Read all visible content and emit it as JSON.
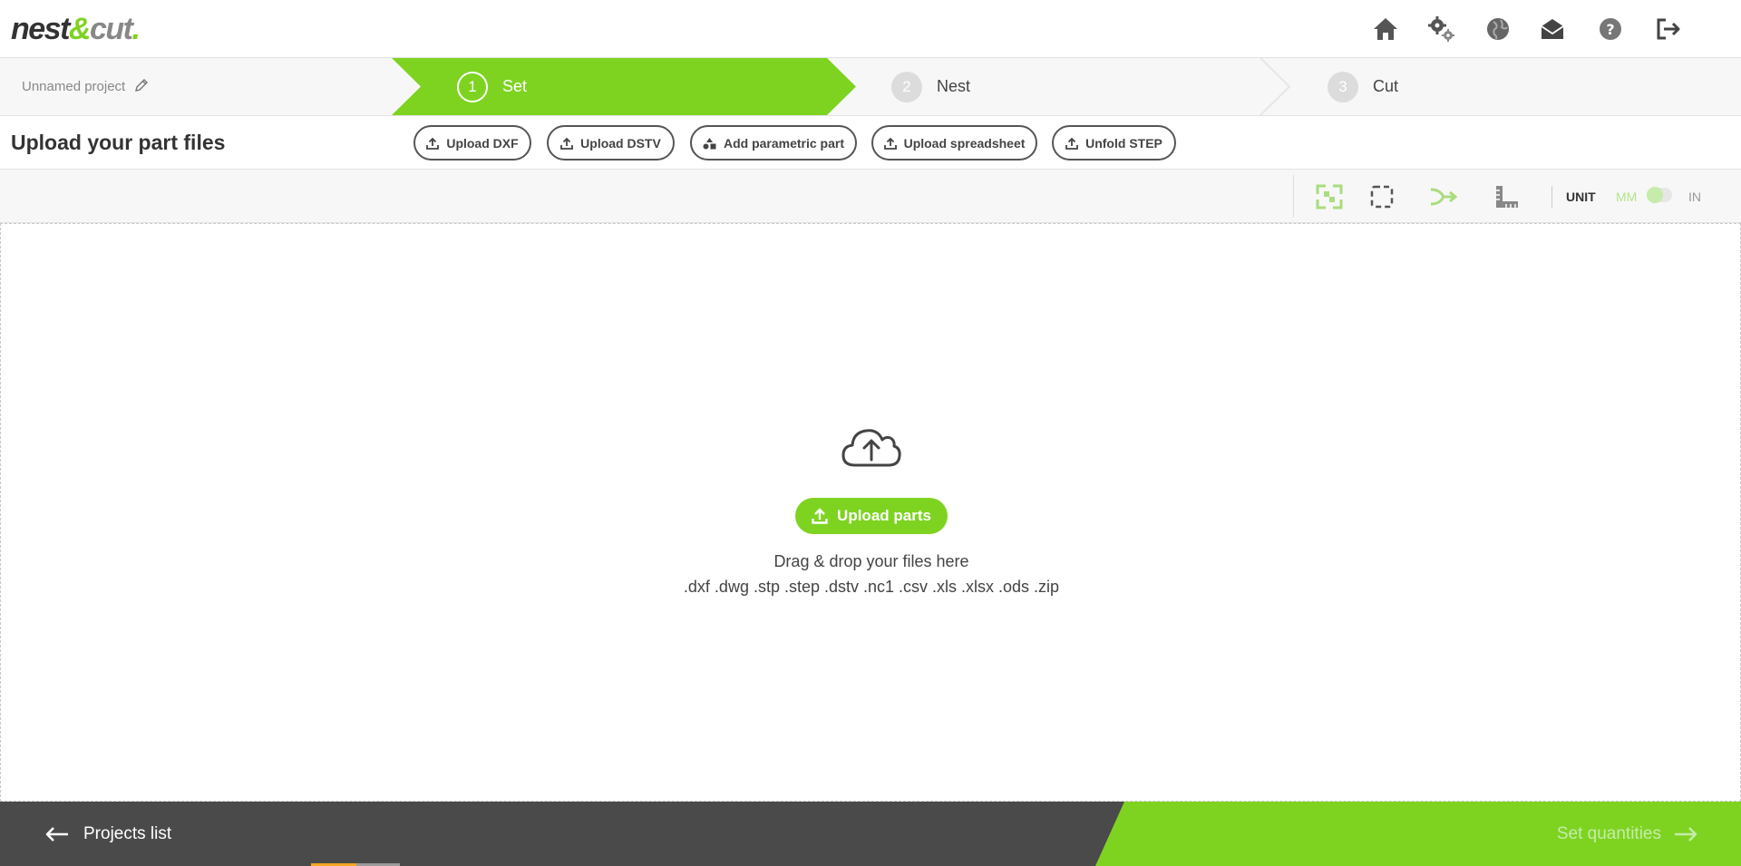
{
  "app": {
    "logo": {
      "part1": "nest",
      "amp": "&",
      "part2": "cut",
      "dot": "."
    }
  },
  "header": {
    "icons": [
      "home-icon",
      "settings-icon",
      "language-globe-icon",
      "mail-icon",
      "help-icon",
      "logout-icon"
    ]
  },
  "steps": {
    "project_name": "Unnamed project",
    "items": [
      {
        "number": "1",
        "label": "Set",
        "active": true
      },
      {
        "number": "2",
        "label": "Nest",
        "active": false
      },
      {
        "number": "3",
        "label": "Cut",
        "active": false
      }
    ]
  },
  "upload": {
    "title": "Upload your part files",
    "buttons": [
      {
        "label": "Upload DXF",
        "icon": "upload-icon"
      },
      {
        "label": "Upload DSTV",
        "icon": "upload-icon"
      },
      {
        "label": "Add parametric part",
        "icon": "shapes-icon"
      },
      {
        "label": "Upload spreadsheet",
        "icon": "upload-icon"
      },
      {
        "label": "Unfold STEP",
        "icon": "upload-icon"
      }
    ]
  },
  "toolbar": {
    "icons": [
      "arrange-icon",
      "select-frame-icon",
      "merge-arrow-icon",
      "ruler-icon"
    ],
    "unit_label": "UNIT",
    "unit_mm": "MM",
    "unit_in": "IN",
    "selected_unit": "MM"
  },
  "dropzone": {
    "icon": "cloud-upload-icon",
    "button_label": "Upload parts",
    "drag_text": "Drag & drop your files here",
    "extensions": ".dxf .dwg .stp .step .dstv .nc1 .csv .xls .xlsx .ods .zip"
  },
  "footer": {
    "back_label": "Projects list",
    "next_label": "Set quantities"
  },
  "colors": {
    "accent": "#7ed321",
    "accent_light": "#c6ebaa",
    "dark": "#4a4a4a",
    "footer_accent": "#f5a623"
  }
}
